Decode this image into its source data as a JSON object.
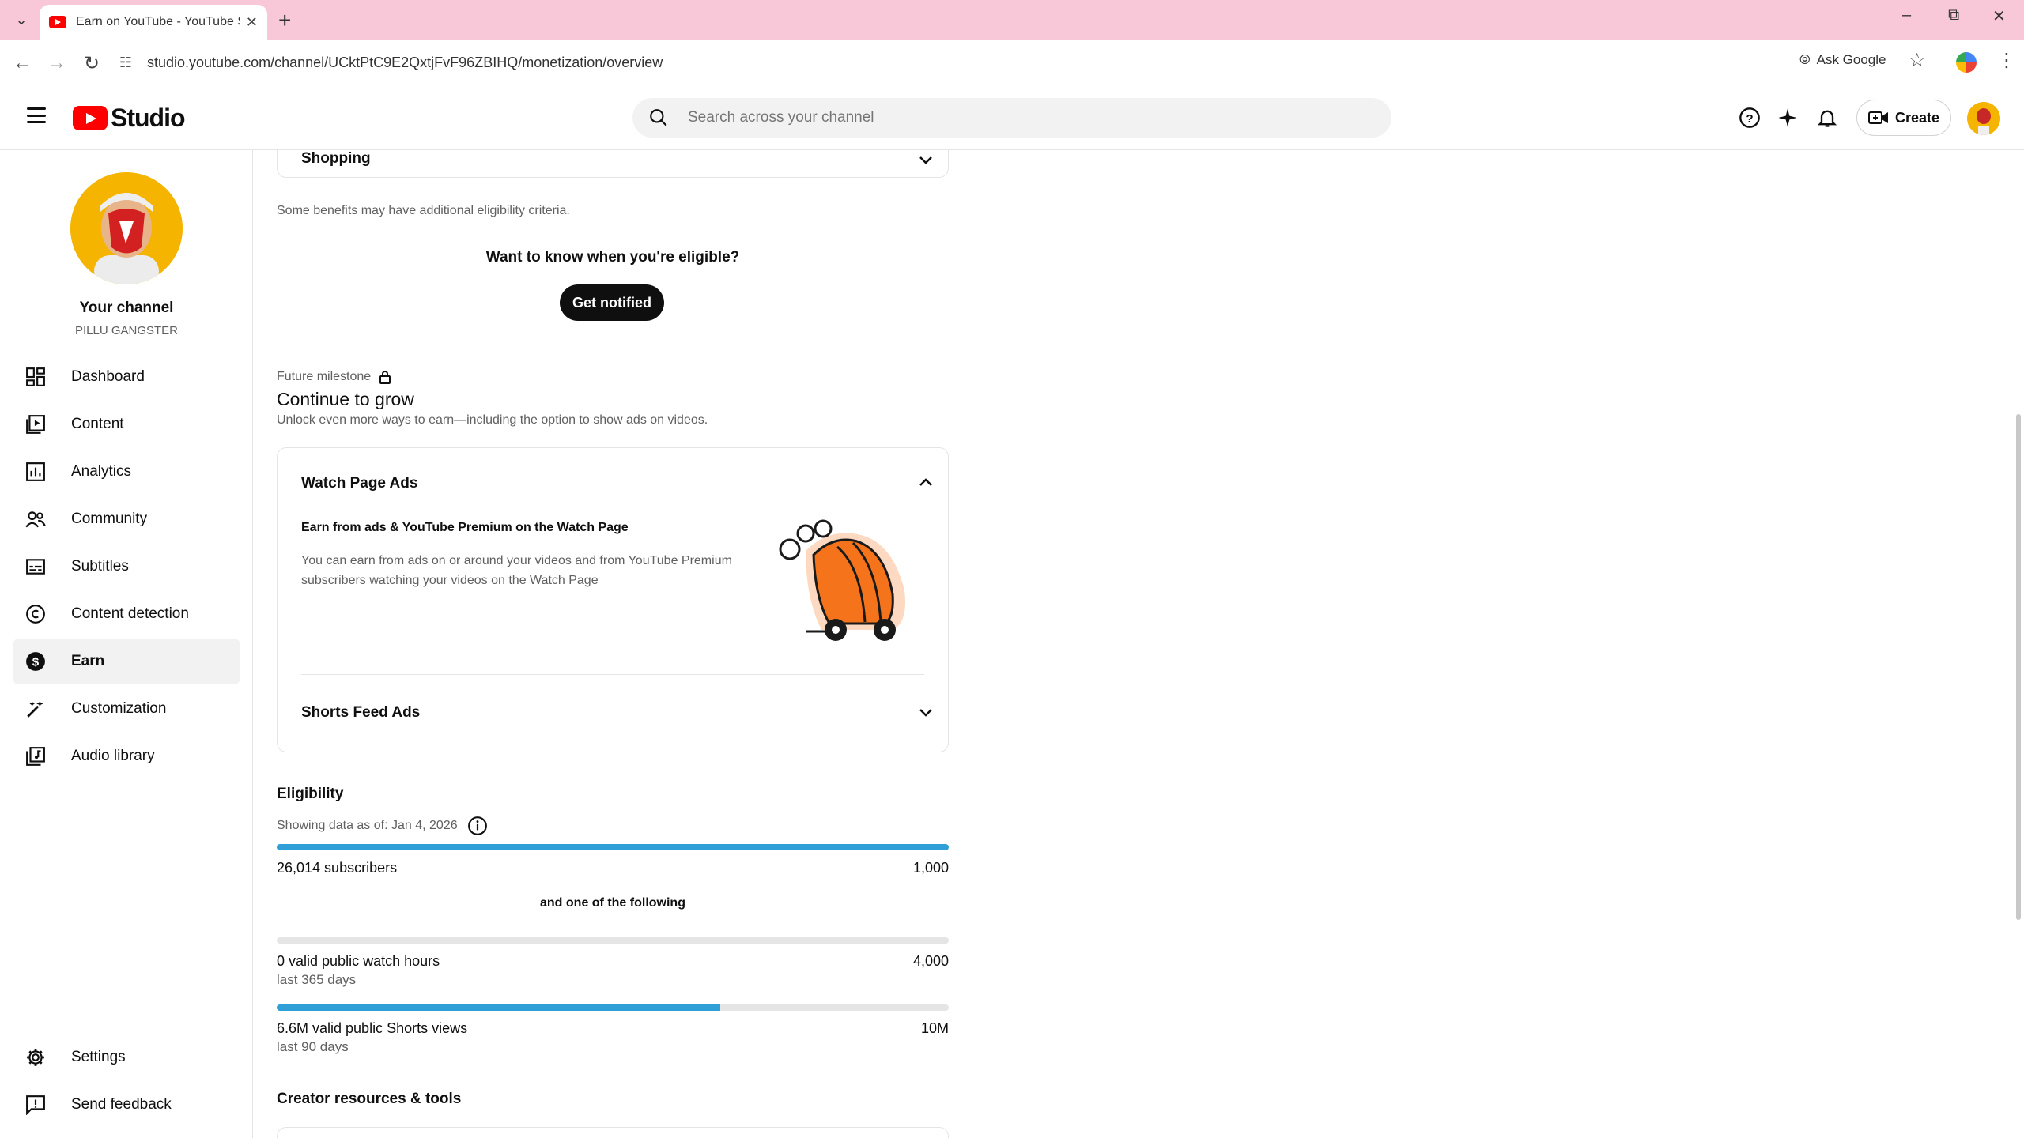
{
  "browser": {
    "tab_title": "Earn on YouTube - YouTube Stu",
    "url": "studio.youtube.com/channel/UCktPtC9E2QxtjFvF96ZBIHQ/monetization/overview",
    "ask_google": "Ask Google"
  },
  "header": {
    "logo_text": "Studio",
    "search_placeholder": "Search across your channel",
    "create_label": "Create"
  },
  "sidebar": {
    "channel_title": "Your channel",
    "channel_name": "PILLU GANGSTER",
    "items": [
      {
        "label": "Dashboard",
        "icon": "dashboard-icon"
      },
      {
        "label": "Content",
        "icon": "content-icon"
      },
      {
        "label": "Analytics",
        "icon": "analytics-icon"
      },
      {
        "label": "Community",
        "icon": "community-icon"
      },
      {
        "label": "Subtitles",
        "icon": "subtitles-icon"
      },
      {
        "label": "Content detection",
        "icon": "copyright-icon"
      },
      {
        "label": "Earn",
        "icon": "dollar-icon"
      },
      {
        "label": "Customization",
        "icon": "magic-wand-icon"
      },
      {
        "label": "Audio library",
        "icon": "audio-library-icon"
      }
    ],
    "settings_label": "Settings",
    "feedback_label": "Send feedback"
  },
  "main": {
    "shopping_label": "Shopping",
    "benefits_note": "Some benefits may have additional eligibility criteria.",
    "eligible_question": "Want to know when you're eligible?",
    "get_notified": "Get notified",
    "milestone_label": "Future milestone",
    "milestone_title": "Continue to grow",
    "milestone_desc": "Unlock even more ways to earn—including the option to show ads on videos.",
    "watch_page_ads": "Watch Page Ads",
    "watch_heading": "Earn from ads & YouTube Premium on the Watch Page",
    "watch_desc": "You can earn from ads on or around your videos and from YouTube Premium subscribers watching your videos on the Watch Page",
    "shorts_feed_ads": "Shorts Feed Ads",
    "eligibility_title": "Eligibility",
    "data_as_of": "Showing data as of: Jan 4, 2026",
    "subscribers_value": "26,014 subscribers",
    "subscribers_target": "1,000",
    "subscribers_progress": 1.0,
    "one_of_following": "and one of the following",
    "watch_hours_value": "0 valid public watch hours",
    "watch_hours_period": "last 365 days",
    "watch_hours_target": "4,000",
    "watch_hours_progress": 0.0,
    "shorts_views_value": "6.6M valid public Shorts views",
    "shorts_views_period": "last 90 days",
    "shorts_views_target": "10M",
    "shorts_views_progress": 0.66,
    "creator_resources": "Creator resources & tools"
  },
  "colors": {
    "accent": "#2f9fd8",
    "brand": "#ff0000",
    "tabbar": "#f8c8d8"
  }
}
